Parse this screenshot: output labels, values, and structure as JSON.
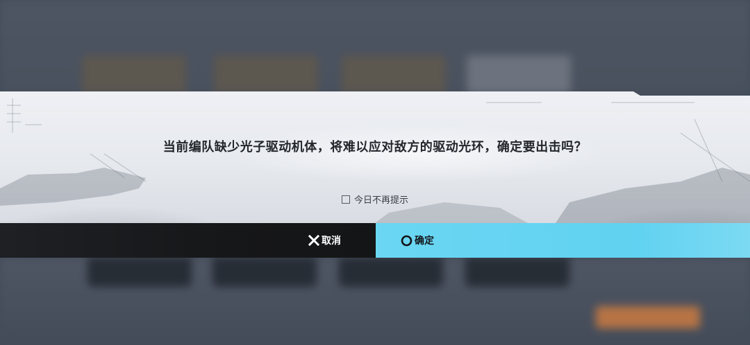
{
  "dialog": {
    "message": "当前编队缺少光子驱动机体，将难以应对敌方的驱动光环，确定要出击吗？",
    "dont_remind_label": "今日不再提示",
    "dont_remind_checked": false
  },
  "buttons": {
    "cancel_label": "取消",
    "cancel_icon": "cross-icon",
    "confirm_label": "确定",
    "confirm_icon": "circle-icon"
  },
  "colors": {
    "confirm_bg": "#61d2f1",
    "cancel_bg": "#161719",
    "panel_bg": "#e6e9ee",
    "message_text": "#23262b"
  }
}
